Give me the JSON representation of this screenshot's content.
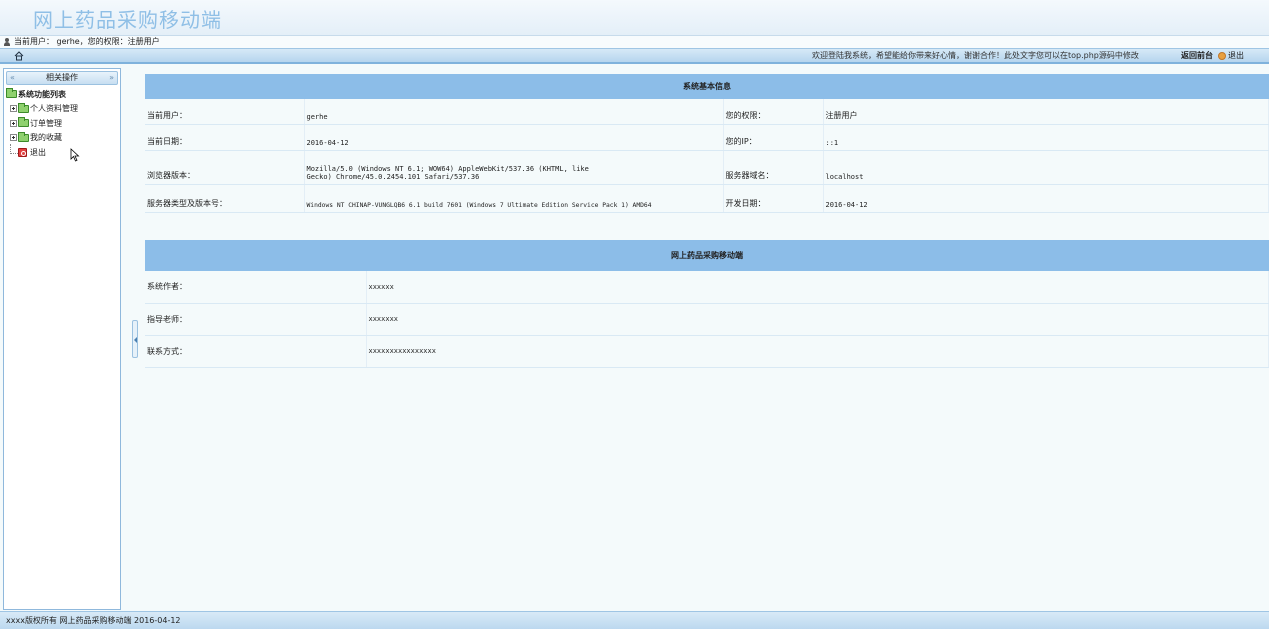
{
  "banner": {
    "title": "网上药品采购移动端"
  },
  "userbar": {
    "text": "当前用户： gerhe，您的权限：注册用户"
  },
  "navbar": {
    "welcome": "欢迎登陆我系统，希望能给你带来好心情，谢谢合作！此处文字您可以在top.php源码中修改",
    "back": "返回前台",
    "logout": "退出"
  },
  "sidebar": {
    "title": "相关操作",
    "root": "系统功能列表",
    "items": [
      {
        "label": "个人资料管理"
      },
      {
        "label": "订单管理"
      },
      {
        "label": "我的收藏"
      },
      {
        "label": "退出"
      }
    ]
  },
  "info": {
    "title": "系统基本信息",
    "rows": [
      {
        "k1": "当前用户：",
        "v1": "gerhe",
        "k2": "您的权限：",
        "v2": "注册用户"
      },
      {
        "k1": "当前日期：",
        "v1": "2016-04-12",
        "k2": "您的IP：",
        "v2": "::1"
      },
      {
        "k1": "浏览器版本：",
        "v1": "Mozilla/5.0 (Windows NT 6.1; WOW64) AppleWebKit/537.36 (KHTML, like Gecko) Chrome/45.0.2454.101 Safari/537.36",
        "k2": "服务器域名：",
        "v2": "localhost"
      },
      {
        "k1": "服务器类型及版本号：",
        "v1": "Windows NT CHINAP-VUNGLQB6 6.1 build 7601 (Windows 7 Ultimate Edition Service Pack 1) AMD64",
        "k2": "开发日期：",
        "v2": "2016-04-12"
      }
    ]
  },
  "about": {
    "title": "网上药品采购移动端",
    "rows": [
      {
        "k": "系统作者：",
        "v": "xxxxxx"
      },
      {
        "k": "指导老师：",
        "v": "xxxxxxx"
      },
      {
        "k": "联系方式：",
        "v": "xxxxxxxxxxxxxxxx"
      }
    ]
  },
  "footer": {
    "text": "xxxx版权所有  网上药品采购移动端 2016-04-12"
  }
}
